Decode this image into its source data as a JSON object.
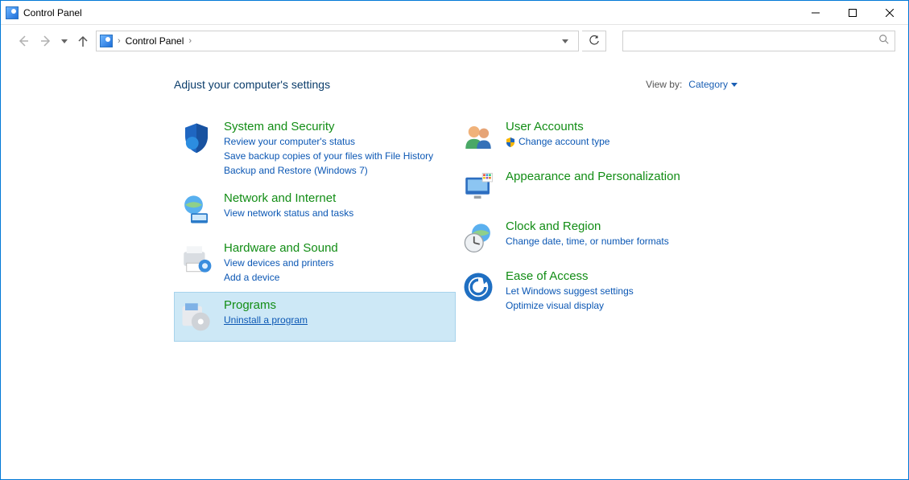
{
  "window": {
    "title": "Control Panel"
  },
  "breadcrumb": {
    "root": "Control Panel"
  },
  "search": {
    "placeholder": ""
  },
  "heading": "Adjust your computer's settings",
  "viewby": {
    "label": "View by:",
    "value": "Category"
  },
  "left": {
    "system": {
      "title": "System and Security",
      "links": [
        "Review your computer's status",
        "Save backup copies of your files with File History",
        "Backup and Restore (Windows 7)"
      ]
    },
    "network": {
      "title": "Network and Internet",
      "links": [
        "View network status and tasks"
      ]
    },
    "hardware": {
      "title": "Hardware and Sound",
      "links": [
        "View devices and printers",
        "Add a device"
      ]
    },
    "programs": {
      "title": "Programs",
      "links": [
        "Uninstall a program"
      ]
    }
  },
  "right": {
    "users": {
      "title": "User Accounts",
      "links": [
        "Change account type"
      ]
    },
    "appearance": {
      "title": "Appearance and Personalization",
      "links": []
    },
    "clock": {
      "title": "Clock and Region",
      "links": [
        "Change date, time, or number formats"
      ]
    },
    "ease": {
      "title": "Ease of Access",
      "links": [
        "Let Windows suggest settings",
        "Optimize visual display"
      ]
    }
  }
}
